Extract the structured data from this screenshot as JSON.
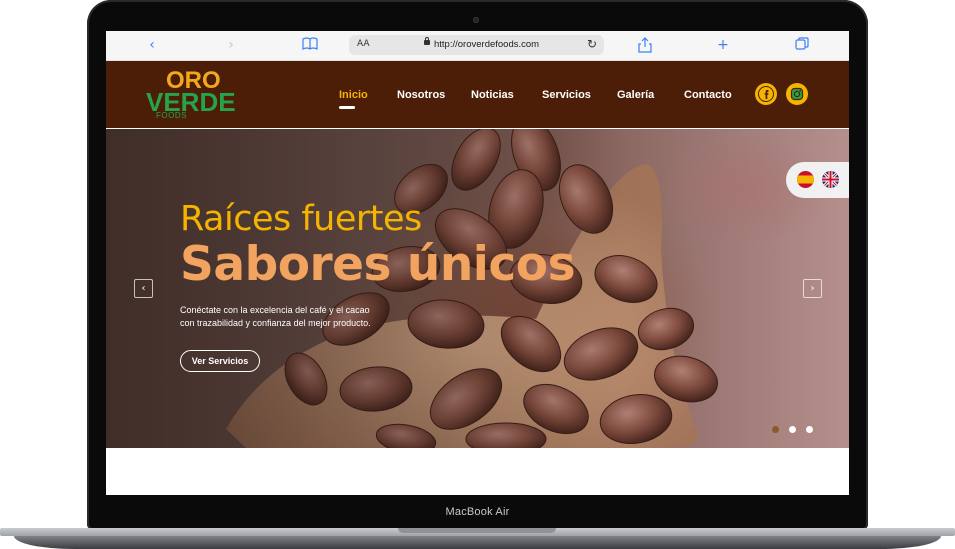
{
  "device": {
    "label": "MacBook Air"
  },
  "browser": {
    "url": "http://oroverdefoods.com",
    "reader_label": "AA",
    "icons": [
      "back-icon",
      "forward-icon",
      "bookmarks-icon",
      "reload-icon",
      "share-icon",
      "new-tab-icon",
      "tabs-icon"
    ]
  },
  "site": {
    "logo": {
      "top": "ORO",
      "middle": "VERDE",
      "bottom": "FOODS"
    },
    "nav": [
      "Inicio",
      "Nosotros",
      "Noticias",
      "Servicios",
      "Galería",
      "Contacto"
    ],
    "active_nav": "Inicio",
    "social": [
      "facebook-icon",
      "instagram-icon"
    ],
    "colors": {
      "header_bg": "#4c1e07",
      "accent": "#f4b400",
      "headline_secondary": "#f1a35f",
      "logo_green": "#27a44a"
    }
  },
  "hero": {
    "title_line1": "Raíces fuertes",
    "title_line2": "Sabores únicos",
    "description_line1": "Conéctate con la excelencia del café y el cacao",
    "description_line2": "con trazabilidad y confianza del mejor producto.",
    "button": "Ver Servicios",
    "languages": [
      "es-flag-icon",
      "uk-flag-icon"
    ],
    "slides_total": 3,
    "active_slide": 1
  }
}
